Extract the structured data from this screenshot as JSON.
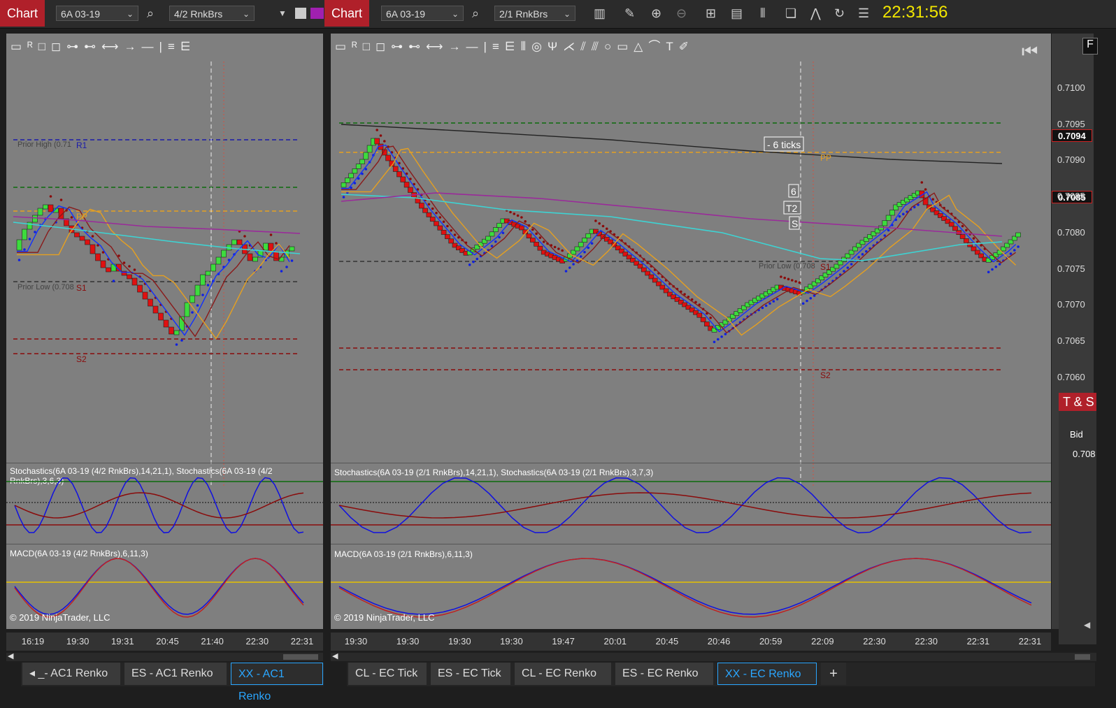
{
  "left": {
    "chart_label": "Chart",
    "instrument": "6A 03-19",
    "bar_type": "4/2 RnkBrs",
    "stoch_label": "Stochastics(6A 03-19 (4/2 RnkBrs),14,21,1), Stochastics(6A 03-19 (4/2 RnkBrs),3,6,3)",
    "macd_label": "MACD(6A 03-19 (4/2 RnkBrs),6,11,3)",
    "copyright": "© 2019 NinjaTrader, LLC",
    "x_ticks": [
      "16:19",
      "19:30",
      "19:31",
      "20:45",
      "21:40",
      "22:30",
      "22:31"
    ],
    "level_labels": {
      "prior_high": "Prior High (0.71",
      "r1": "R1",
      "pp": "PP",
      "prior_low": "Prior Low (0.708",
      "s1": "S1",
      "s2": "S2"
    },
    "tabs": [
      "_- AC1 Renko",
      "ES - AC1 Renko",
      "XX - AC1 Renko"
    ],
    "active_tab": "XX - AC1 Renko"
  },
  "right": {
    "chart_label": "Chart",
    "instrument": "6A 03-19",
    "bar_type": "2/1 RnkBrs",
    "clock": "22:31:56",
    "stoch_label": "Stochastics(6A 03-19 (2/1 RnkBrs),14,21,1), Stochastics(6A 03-19 (2/1 RnkBrs),3,7,3)",
    "macd_label": "MACD(6A 03-19 (2/1 RnkBrs),6,11,3)",
    "copyright": "© 2019 NinjaTrader, LLC",
    "x_ticks": [
      "19:30",
      "19:30",
      "19:30",
      "19:30",
      "19:47",
      "20:01",
      "20:45",
      "20:46",
      "20:59",
      "22:09",
      "22:30",
      "22:30",
      "22:31",
      "22:31"
    ],
    "price_ticks": [
      "0.7100",
      "0.7095",
      "0.7090",
      "0.7085",
      "0.7080",
      "0.7075",
      "0.7070",
      "0.7065",
      "0.7060"
    ],
    "price_tags": {
      "upper": "0.7094",
      "current": "0.7085"
    },
    "level_labels": {
      "pp": "PP",
      "prior_low": "Prior Low (0.708",
      "s1": "S1",
      "s2": "S2"
    },
    "annotations": {
      "ticks": "- 6 ticks",
      "t6": "6",
      "t2": "T2",
      "ts": "S"
    },
    "tabs": [
      "CL - EC Tick",
      "ES - EC Tick",
      "CL - EC Renko",
      "ES - EC Renko",
      "XX - EC Renko"
    ],
    "active_tab": "XX - EC Renko",
    "add_tab": "+",
    "side_panel": {
      "title": "T & S",
      "bid_header": "Bid",
      "bid_value": "0.708",
      "edge_letter": "F"
    }
  },
  "colors": {
    "panel_bg": "#7f7f7f",
    "up": "#3ddc3d",
    "down": "#e01010",
    "title_red": "#b0202a",
    "clock": "#f2e600",
    "active_tab": "#2aa6ff"
  }
}
